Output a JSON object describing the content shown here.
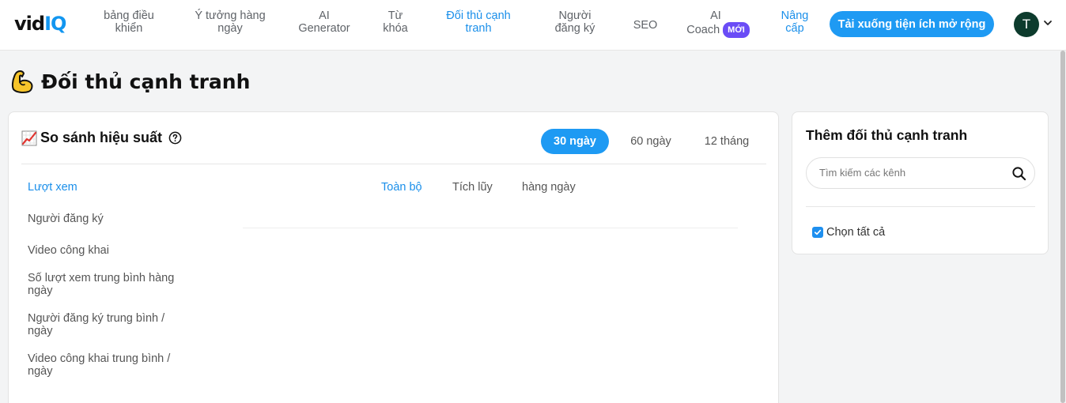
{
  "nav": {
    "logo_a": "vid",
    "logo_b": "IQ",
    "items": [
      {
        "l1": "bảng điều",
        "l2": "khiển"
      },
      {
        "l1": "Ý tưởng hàng",
        "l2": "ngày"
      },
      {
        "l1": "AI",
        "l2": "Generator"
      },
      {
        "l1": "Từ",
        "l2": "khóa"
      },
      {
        "l1": "Đối thủ cạnh",
        "l2": "tranh"
      },
      {
        "l1": "Người",
        "l2": "đăng ký"
      },
      {
        "l1": "SEO",
        "l2": ""
      },
      {
        "l1": "AI",
        "l2": "Coach"
      },
      {
        "l1": "Nâng",
        "l2": "cấp"
      }
    ],
    "new_badge": "MỚI",
    "download_button": "Tải xuống tiện ích mở rộng",
    "avatar_initial": "T"
  },
  "page": {
    "title": "Đối thủ cạnh tranh"
  },
  "performance": {
    "title": "So sánh hiệu suất",
    "ranges": [
      "30 ngày",
      "60 ngày",
      "12 tháng"
    ],
    "selected_range": "30 ngày",
    "metrics": [
      "Lượt xem",
      "Người đăng ký",
      "Video công khai",
      "Số lượt xem trung bình hàng ngày",
      "Người đăng ký trung bình / ngày",
      "Video công khai trung bình / ngày"
    ],
    "selected_metric": "Lượt xem",
    "tabs": [
      "Toàn bộ",
      "Tích lũy",
      "hàng ngày"
    ],
    "selected_tab": "Toàn bộ"
  },
  "competitors": {
    "title": "Thêm đối thủ cạnh tranh",
    "search_placeholder": "Tìm kiếm các kênh",
    "select_all_label": "Chọn tất cả",
    "select_all_checked": true
  },
  "colors": {
    "accent": "#1e9af3",
    "new_badge": "#6a4cf6",
    "avatar": "#0d3b2d"
  }
}
